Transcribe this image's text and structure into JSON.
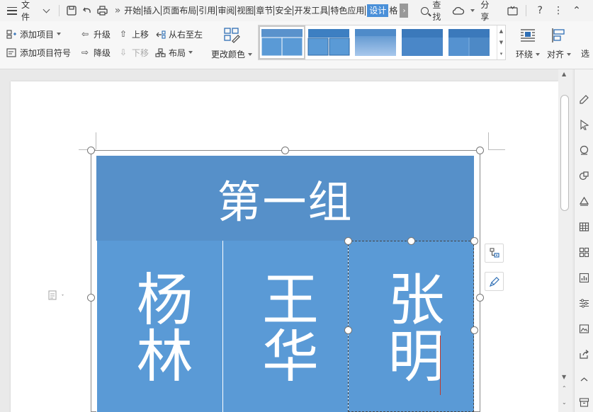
{
  "menubar": {
    "file_label": "文件",
    "tabs": [
      "开始",
      "插入",
      "页面布局",
      "引用",
      "审阅",
      "视图",
      "章节",
      "安全",
      "开发工具",
      "特色应用"
    ],
    "active_tab": "设计",
    "more_tab": "格",
    "search_label": "查找",
    "share_label": "分享",
    "help_label": "?"
  },
  "ribbon": {
    "add_item": "添加项目",
    "add_item_bullet": "添加项目符号",
    "promote": "升级",
    "demote": "降级",
    "move_up": "上移",
    "move_down": "下移",
    "right_to_left": "从右至左",
    "layout": "布局",
    "change_color": "更改颜色",
    "wrap": "环绕",
    "align": "对齐",
    "select": "选"
  },
  "smartart": {
    "top_node": "第一组",
    "nodes": [
      {
        "text": "杨林"
      },
      {
        "text": "王华"
      },
      {
        "text": "张明"
      }
    ]
  },
  "colors": {
    "top_node": "#5690c9",
    "child_node": "#5a9ad6",
    "active_tab": "#4a90d9"
  }
}
